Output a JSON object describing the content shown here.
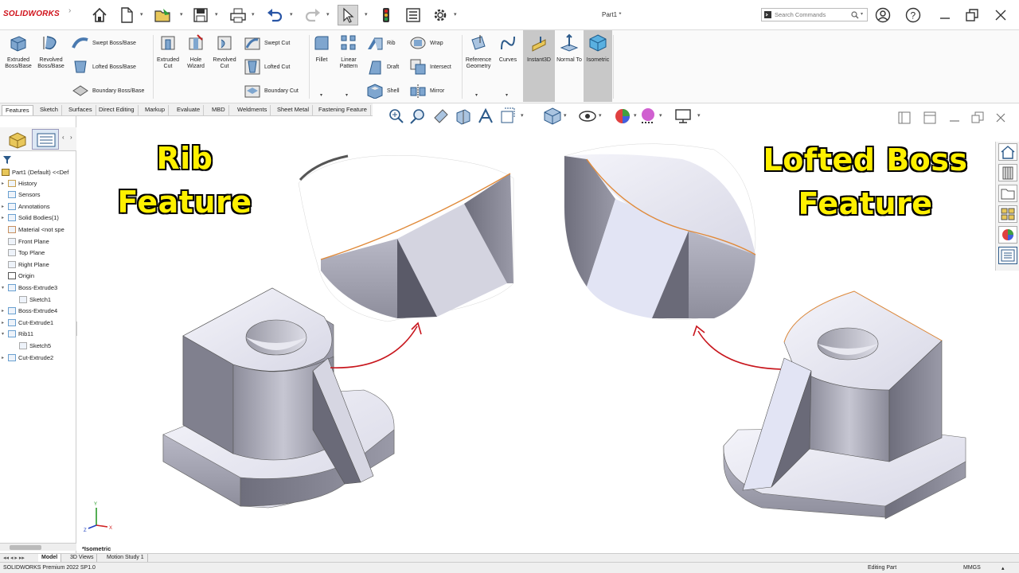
{
  "app": {
    "logo_text": "SOLIDWORKS",
    "window_title": "Part1 *",
    "search_placeholder": "Search Commands"
  },
  "ribbon": {
    "extruded_boss": "Extruded Boss/Base",
    "revolved_boss": "Revolved Boss/Base",
    "swept_boss": "Swept Boss/Base",
    "lofted_boss": "Lofted Boss/Base",
    "boundary_boss": "Boundary Boss/Base",
    "extruded_cut": "Extruded Cut",
    "hole_wizard": "Hole Wizard",
    "revolved_cut": "Revolved Cut",
    "swept_cut": "Swept Cut",
    "lofted_cut": "Lofted Cut",
    "boundary_cut": "Boundary Cut",
    "fillet": "Fillet",
    "linear_pattern": "Linear Pattern",
    "rib": "Rib",
    "draft": "Draft",
    "shell": "Shell",
    "wrap": "Wrap",
    "intersect": "Intersect",
    "mirror": "Mirror",
    "reference_geometry": "Reference Geometry",
    "curves": "Curves",
    "instant3d": "Instant3D",
    "normal_to": "Normal To",
    "isometric": "Isometric"
  },
  "tabs": [
    "Features",
    "Sketch",
    "Surfaces",
    "Direct Editing",
    "Markup",
    "Evaluate",
    "MBD",
    "Weldments",
    "Sheet Metal",
    "Fastening Feature"
  ],
  "tree": {
    "root": "Part1 (Default) <<Def",
    "items": [
      {
        "label": "History",
        "exp": "▸"
      },
      {
        "label": "Sensors",
        "exp": ""
      },
      {
        "label": "Annotations",
        "exp": "▸"
      },
      {
        "label": "Solid Bodies(1)",
        "exp": "▸"
      },
      {
        "label": "Material <not spe",
        "exp": ""
      },
      {
        "label": "Front Plane",
        "exp": ""
      },
      {
        "label": "Top Plane",
        "exp": ""
      },
      {
        "label": "Right Plane",
        "exp": ""
      },
      {
        "label": "Origin",
        "exp": ""
      },
      {
        "label": "Boss-Extrude3",
        "exp": "▾"
      },
      {
        "label": "Sketch1",
        "exp": ""
      },
      {
        "label": "Boss-Extrude4",
        "exp": "▸"
      },
      {
        "label": "Cut-Extrude1",
        "exp": "▸"
      },
      {
        "label": "Rib11",
        "exp": "▾"
      },
      {
        "label": "Sketch5",
        "exp": ""
      },
      {
        "label": "Cut-Extrude2",
        "exp": "▸"
      }
    ]
  },
  "canvas": {
    "title_left_line1": "Rib",
    "title_left_line2": "Feature",
    "title_right_line1": "Lofted Boss",
    "title_right_line2": "Feature",
    "view_label": "*Isometric"
  },
  "bottom_tabs": [
    "Model",
    "3D Views",
    "Motion Study 1"
  ],
  "status": {
    "version": "SOLIDWORKS Premium 2022 SP1.0",
    "mode": "Editing Part",
    "units": "MMGS"
  },
  "colors": {
    "logo_red": "#d0121b",
    "title_yellow": "#fff000",
    "arrow_red": "#c8161d"
  }
}
